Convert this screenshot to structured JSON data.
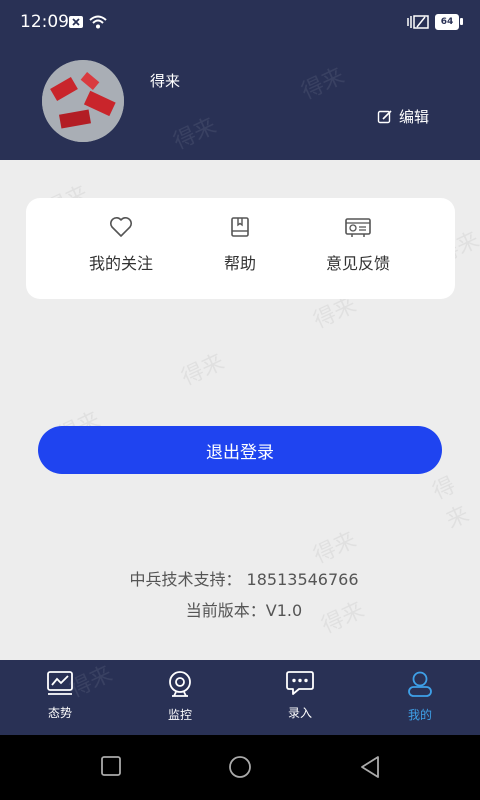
{
  "status_bar": {
    "time": "12:09",
    "battery": "64"
  },
  "profile": {
    "username": "得来",
    "edit_label": "编辑"
  },
  "menu": {
    "items": [
      {
        "label": "我的关注",
        "icon": "heart-icon"
      },
      {
        "label": "帮助",
        "icon": "book-icon"
      },
      {
        "label": "意见反馈",
        "icon": "feedback-icon"
      }
    ]
  },
  "logout_label": "退出登录",
  "support_text": "中兵技术支持：  18513546766",
  "version_text": "当前版本：V1.0",
  "tabs": [
    {
      "label": "态势",
      "icon": "chart-icon"
    },
    {
      "label": "监控",
      "icon": "camera-icon"
    },
    {
      "label": "录入",
      "icon": "chat-icon"
    },
    {
      "label": "我的",
      "icon": "user-icon",
      "active": true
    }
  ],
  "watermark": "得来",
  "colors": {
    "header_bg": "#293155",
    "accent": "#1f44f0",
    "active_tab": "#3ea0e8",
    "page_bg": "#ededed"
  }
}
